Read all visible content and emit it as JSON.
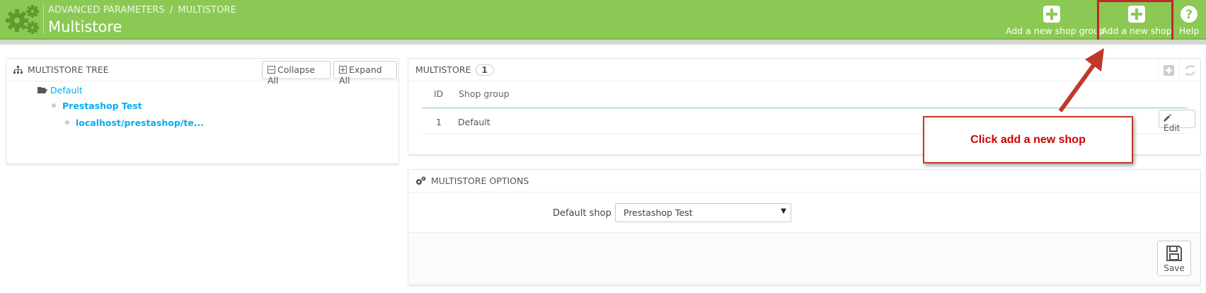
{
  "header": {
    "breadcrumb": [
      "ADVANCED PARAMETERS",
      "MULTISTORE"
    ],
    "breadcrumb_sep": "/",
    "title": "Multistore",
    "toolbar": {
      "add_group_label": "Add a new shop group",
      "add_shop_label": "Add a new shop",
      "help_label": "Help"
    }
  },
  "tree_panel": {
    "title": "MULTISTORE TREE",
    "collapse_label": "Collapse All",
    "expand_label": "Expand All",
    "items": [
      "Default",
      "Prestashop Test",
      "localhost/prestashop/te..."
    ]
  },
  "multistore_panel": {
    "title": "MULTISTORE",
    "count": "1",
    "columns": [
      "ID",
      "Shop group"
    ],
    "rows": [
      {
        "id": "1",
        "name": "Default",
        "action": "Edit"
      }
    ]
  },
  "options_panel": {
    "title": "MULTISTORE OPTIONS",
    "default_shop_label": "Default shop",
    "default_shop_value": "Prestashop Test",
    "save_label": "Save"
  },
  "annotation": {
    "text": "Click add a new shop"
  },
  "colors": {
    "header_green": "#8bc954",
    "link_blue": "#00aff0",
    "annotation_red": "#c0392b"
  }
}
